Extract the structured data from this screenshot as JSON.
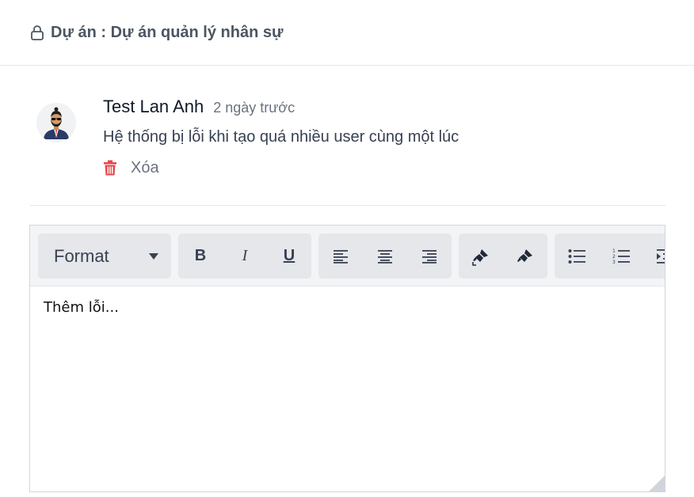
{
  "header": {
    "title": "Dự án : Dự án quản lý nhân sự",
    "icon": "lock-icon"
  },
  "comment": {
    "author": "Test Lan Anh",
    "time": "2 ngày trước",
    "text": "Hệ thống bị lỗi khi tạo quá nhiều user cùng một lúc",
    "delete_label": "Xóa",
    "delete_color": "#e5484d"
  },
  "editor": {
    "toolbar": {
      "format_label": "Format",
      "bold_label": "B",
      "italic_label": "I",
      "underline_label": "U"
    },
    "content": "Thêm lỗi..."
  }
}
